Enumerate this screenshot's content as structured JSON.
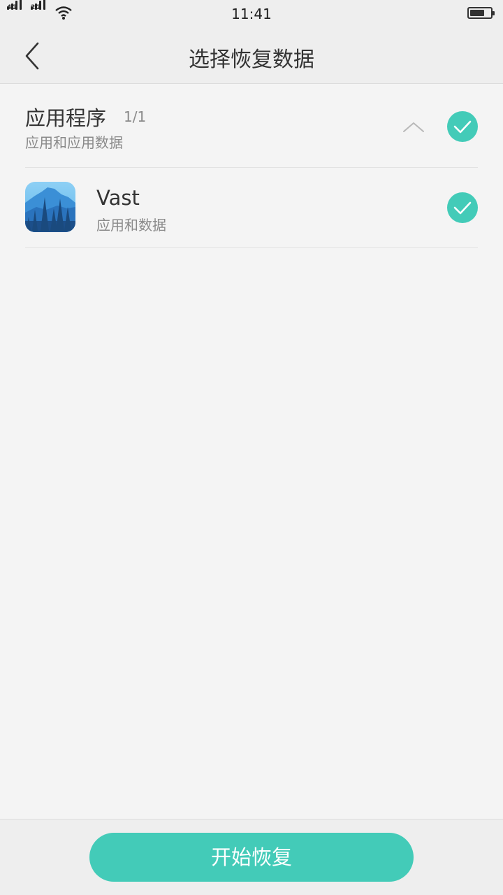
{
  "status_bar": {
    "signal_1_label": "4G",
    "signal_2_label": "2G",
    "time": "11:41",
    "icons": [
      "signal-icon",
      "signal-icon",
      "wifi-icon",
      "battery-icon"
    ]
  },
  "header": {
    "title": "选择恢复数据",
    "back_icon": "chevron-left-icon"
  },
  "group": {
    "title": "应用程序",
    "count": "1/1",
    "subtitle": "应用和应用数据",
    "toggle_icon": "chevron-up-icon",
    "checked": true
  },
  "apps": [
    {
      "name": "Vast",
      "subtitle": "应用和数据",
      "icon": "vast-app-icon",
      "checked": true
    }
  ],
  "footer": {
    "start_label": "开始恢复"
  },
  "colors": {
    "accent": "#43cbb8",
    "background": "#f4f4f4",
    "bar_background": "#eeeeee"
  }
}
